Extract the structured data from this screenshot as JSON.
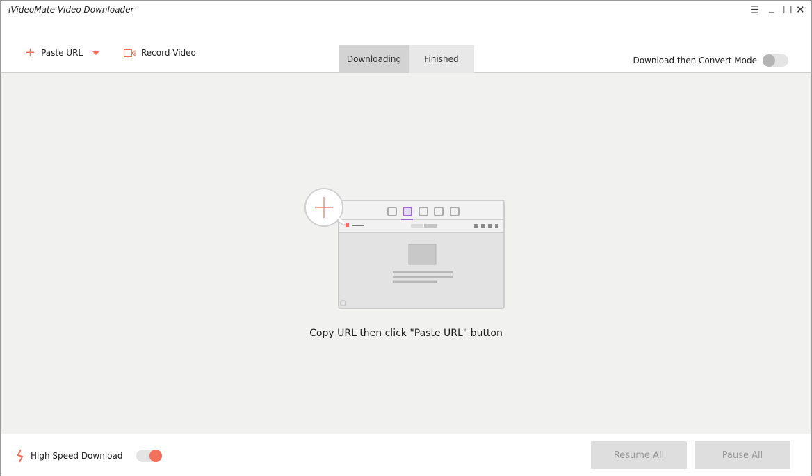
{
  "app": {
    "title": "iVideoMate Video Downloader"
  },
  "window_controls": {
    "menu": "☰",
    "minimize": "_",
    "maximize": "☐",
    "close": "✕"
  },
  "toolbar": {
    "paste_url": "Paste URL",
    "record_video": "Record Video"
  },
  "tabs": [
    {
      "label": "Downloading",
      "active": true
    },
    {
      "label": "Finished",
      "active": false
    }
  ],
  "convert_mode": {
    "label": "Download then Convert Mode",
    "enabled": false
  },
  "main": {
    "hint": "Copy URL then click \"Paste URL\" button"
  },
  "footer": {
    "high_speed_label": "High Speed Download",
    "high_speed_enabled": true,
    "resume_all": "Resume All",
    "pause_all": "Pause All"
  },
  "colors": {
    "accent": "#f36f5b",
    "highlight": "#9b6ad9"
  }
}
